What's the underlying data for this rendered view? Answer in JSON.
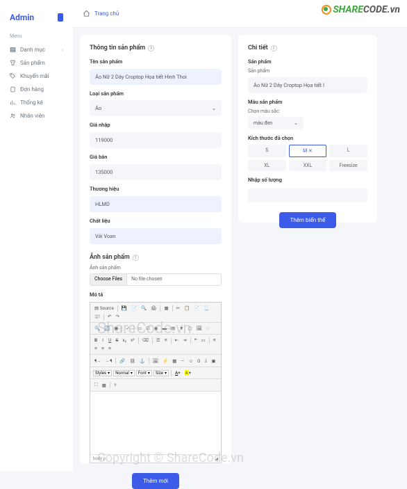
{
  "app_title": "Admin",
  "menu_label": "Menu",
  "sidebar": {
    "items": [
      {
        "label": "Danh mục",
        "icon": "list"
      },
      {
        "label": "Sản phẩm",
        "icon": "shirt"
      },
      {
        "label": "Khuyến mãi",
        "icon": "tag"
      },
      {
        "label": "Đơn hàng",
        "icon": "file"
      },
      {
        "label": "Thống kê",
        "icon": "chart"
      },
      {
        "label": "Nhân viên",
        "icon": "users"
      }
    ]
  },
  "breadcrumb": {
    "home": "Trang chủ"
  },
  "logo": {
    "text1": "SHARE",
    "text2": "CODE.vn"
  },
  "info": {
    "title": "Thông tin sản phẩm",
    "name_label": "Tên sản phẩm",
    "name_value": "Áo Nữ 2 Dây Croptop Họa tiết Hình Thoi",
    "type_label": "Loại sản phẩm",
    "type_value": "Áo",
    "import_label": "Giá nhập",
    "import_value": "119000",
    "price_label": "Giá bán",
    "price_value": "135000",
    "brand_label": "Thương hiệu",
    "brand_value": "HLMD",
    "material_label": "Chất liệu",
    "material_value": "Vải Voan",
    "image_title": "Ảnh sản phẩm",
    "image_label": "Ảnh sản phẩm",
    "choose_files": "Choose Files",
    "no_file": "No file chosen",
    "desc_label": "Mô tả",
    "submit": "Thêm mới"
  },
  "editor": {
    "source": "Source",
    "styles": "Styles",
    "normal": "Normal",
    "font": "Font",
    "size": "Size",
    "body": "body",
    "p": "p"
  },
  "detail": {
    "title": "Chi tiết",
    "product_label": "Sản phẩm",
    "product_sub": "Sản phẩm",
    "product_value": "Áo Nữ 2 Dây Croptop Họa tiết I",
    "color_label": "Màu sản phẩm",
    "color_sub": "Chọn màu sắc:",
    "color_value": "màu đen",
    "size_label": "Kích thước đã chọn",
    "sizes": [
      "S",
      "M",
      "L",
      "XL",
      "XXL",
      "Freesize"
    ],
    "active_size_idx": 1,
    "qty_label": "Nhập số lượng",
    "add_variant": "Thêm biến thể"
  },
  "wm1": "ShareCode.vn",
  "wm2": "Copyright © ShareCode.vn"
}
